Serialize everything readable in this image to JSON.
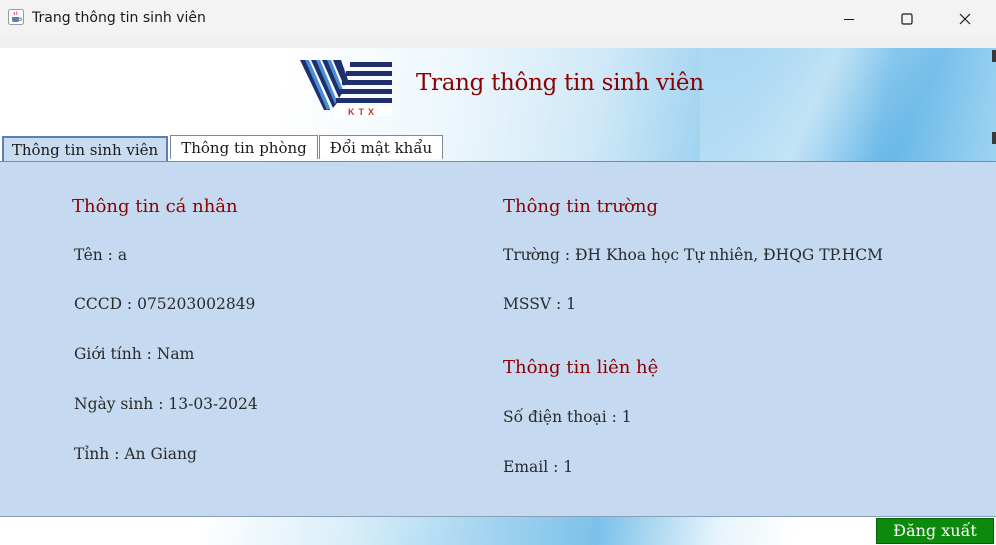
{
  "window": {
    "title": "Trang thông tin sinh viên",
    "icon": "java-cup-icon"
  },
  "header": {
    "logo_text": "KTX",
    "title": "Trang thông tin sinh viên"
  },
  "tabs": [
    {
      "label": "Thông tin sinh viên",
      "active": true
    },
    {
      "label": "Thông tin phòng",
      "active": false
    },
    {
      "label": "Đổi mật khẩu",
      "active": false
    }
  ],
  "personal": {
    "title": "Thông tin cá nhân",
    "name": "Tên : a",
    "cccd": "CCCD : 075203002849",
    "gender": "Giới tính : Nam",
    "dob": "Ngày sinh : 13-03-2024",
    "province": "Tỉnh : An Giang"
  },
  "school": {
    "title": "Thông tin trường",
    "school": "Trường : ĐH Khoa học Tự nhiên, ĐHQG TP.HCM",
    "mssv": "MSSV : 1"
  },
  "contact": {
    "title": "Thông tin liên hệ",
    "phone": "Số điện thoại : 1",
    "email": "Email : 1"
  },
  "footer": {
    "logout_label": "Đăng xuất"
  },
  "colors": {
    "title_red": "#8b0000",
    "panel_bg": "#c5daf0",
    "logout_green": "#0c8a0c"
  }
}
